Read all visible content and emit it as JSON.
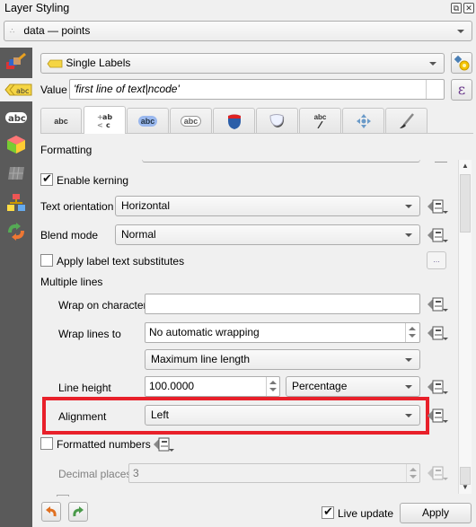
{
  "window": {
    "title": "Layer Styling",
    "float_button": "⧉",
    "close_button": "✕"
  },
  "layer_selector": {
    "value": "data — points"
  },
  "renderer": {
    "mode": "Single Labels"
  },
  "value_field": {
    "label": "Value",
    "expression": "'first line of text|ncode'",
    "expression_button": "ε"
  },
  "sidebar": {
    "items": [
      {
        "name": "symbology",
        "icon": "paintbrush-icon"
      },
      {
        "name": "labels",
        "icon": "label-abc-icon"
      },
      {
        "name": "masks",
        "icon": "abc-mask-icon"
      },
      {
        "name": "3d-view",
        "icon": "3d-cube-icon"
      },
      {
        "name": "diagrams",
        "icon": "diagram-icon"
      },
      {
        "name": "attributes-form",
        "icon": "form-icon"
      },
      {
        "name": "history",
        "icon": "undo-redo-icon"
      }
    ]
  },
  "tabs": [
    {
      "name": "text",
      "label": "abc"
    },
    {
      "name": "formatting",
      "label": "+ab < c",
      "active": true
    },
    {
      "name": "buffer",
      "label": "abc"
    },
    {
      "name": "mask",
      "label": "abc"
    },
    {
      "name": "background",
      "label": ""
    },
    {
      "name": "shadow",
      "label": ""
    },
    {
      "name": "callouts",
      "label": "abc"
    },
    {
      "name": "placement",
      "label": ""
    },
    {
      "name": "rendering",
      "label": ""
    }
  ],
  "formatting": {
    "section_title": "Formatting",
    "enable_kerning": {
      "label": "Enable kerning",
      "checked": true
    },
    "text_orientation": {
      "label": "Text orientation",
      "value": "Horizontal"
    },
    "blend_mode": {
      "label": "Blend mode",
      "value": "Normal"
    },
    "apply_substitutes": {
      "label": "Apply label text substitutes",
      "checked": false,
      "button": "..."
    },
    "multiple_lines": {
      "title": "Multiple lines",
      "wrap_on_character": {
        "label": "Wrap on character",
        "value": ""
      },
      "wrap_lines_to": {
        "label": "Wrap lines to",
        "value": "No automatic wrapping"
      },
      "wrap_mode": {
        "value": "Maximum line length"
      },
      "line_height": {
        "label": "Line height",
        "value": "100.0000",
        "unit": "Percentage"
      },
      "alignment": {
        "label": "Alignment",
        "value": "Left"
      }
    },
    "formatted_numbers": {
      "label": "Formatted numbers",
      "checked": false
    },
    "decimal_places": {
      "label": "Decimal places",
      "value": "3"
    }
  },
  "footer": {
    "live_update": {
      "label": "Live update",
      "checked": true
    },
    "apply_button": "Apply"
  },
  "highlight": {
    "color": "#e8202a"
  }
}
